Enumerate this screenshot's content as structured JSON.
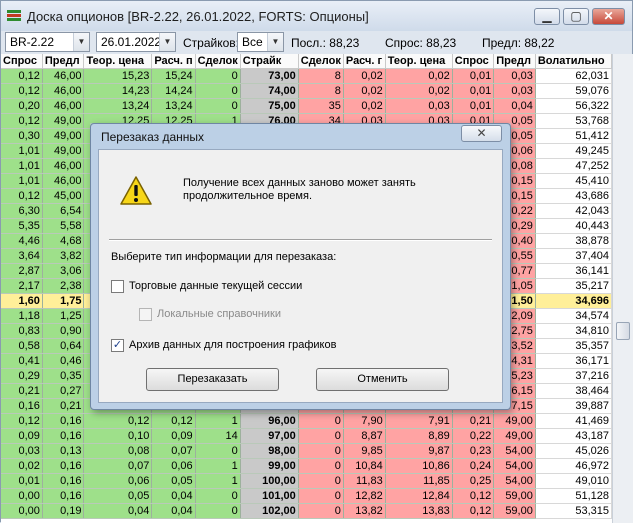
{
  "window": {
    "title": "Доска опционов [BR-2.22, 26.01.2022, FORTS: Опционы]",
    "buttons": {
      "minimize": "▁",
      "maximize": "▢",
      "close": "✕"
    }
  },
  "toolbar": {
    "instrument": "BR-2.22",
    "date": "26.01.2022",
    "strikes_label": "Страйков:",
    "strikes_value": "Все",
    "last_label": "Посл.: 88,23",
    "bid_label": "Спрос: 88,23",
    "ask_label": "Предл: 88,22"
  },
  "columns": [
    "Спрос",
    "Предл",
    "Теор. цена",
    "Расч. п",
    "Сделок",
    "Страйк",
    "Сделок",
    "Расч. г",
    "Теор. цена",
    "Спрос",
    "Предл",
    "Волатильно"
  ],
  "rows": [
    [
      "0,12",
      "46,00",
      "15,23",
      "15,24",
      "0",
      "73,00",
      "8",
      "0,02",
      "0,02",
      "0,01",
      "0,03",
      "62,031"
    ],
    [
      "0,12",
      "46,00",
      "14,23",
      "14,24",
      "0",
      "74,00",
      "8",
      "0,02",
      "0,02",
      "0,01",
      "0,03",
      "59,076"
    ],
    [
      "0,20",
      "46,00",
      "13,24",
      "13,24",
      "0",
      "75,00",
      "35",
      "0,02",
      "0,03",
      "0,01",
      "0,04",
      "56,322"
    ],
    [
      "0,12",
      "49,00",
      "12,25",
      "12,25",
      "1",
      "76,00",
      "34",
      "0,03",
      "0,03",
      "0,01",
      "0,05",
      "53,768"
    ],
    [
      "0,30",
      "49,00",
      "",
      "",
      "",
      "",
      "",
      "",
      "",
      "",
      "0,05",
      "51,412"
    ],
    [
      "1,01",
      "49,00",
      "",
      "",
      "",
      "",
      "",
      "",
      "",
      "",
      "0,06",
      "49,245"
    ],
    [
      "1,01",
      "46,00",
      "",
      "",
      "",
      "",
      "",
      "",
      "",
      "",
      "0,08",
      "47,252"
    ],
    [
      "1,01",
      "46,00",
      "",
      "",
      "",
      "",
      "",
      "",
      "",
      "",
      "0,15",
      "45,410"
    ],
    [
      "0,12",
      "45,00",
      "",
      "",
      "",
      "",
      "",
      "",
      "",
      "",
      "0,15",
      "43,686"
    ],
    [
      "6,30",
      "6,54",
      "",
      "",
      "",
      "",
      "",
      "",
      "",
      "",
      "0,22",
      "42,043"
    ],
    [
      "5,35",
      "5,58",
      "",
      "",
      "",
      "",
      "",
      "",
      "",
      "",
      "0,29",
      "40,443"
    ],
    [
      "4,46",
      "4,68",
      "",
      "",
      "",
      "",
      "",
      "",
      "",
      "",
      "0,40",
      "38,878"
    ],
    [
      "3,64",
      "3,82",
      "",
      "",
      "",
      "",
      "",
      "",
      "",
      "",
      "0,55",
      "37,404"
    ],
    [
      "2,87",
      "3,06",
      "",
      "",
      "",
      "",
      "",
      "",
      "",
      "",
      "0,77",
      "36,141"
    ],
    [
      "2,17",
      "2,38",
      "",
      "",
      "",
      "",
      "",
      "",
      "",
      "",
      "1,05",
      "35,217"
    ],
    [
      "1,60",
      "1,75",
      "",
      "",
      "",
      "",
      "",
      "",
      "",
      "",
      "1,50",
      "34,696"
    ],
    [
      "1,18",
      "1,25",
      "",
      "",
      "",
      "",
      "",
      "",
      "",
      "",
      "2,09",
      "34,574"
    ],
    [
      "0,83",
      "0,90",
      "",
      "",
      "",
      "",
      "",
      "",
      "",
      "",
      "2,75",
      "34,810"
    ],
    [
      "0,58",
      "0,64",
      "",
      "",
      "",
      "",
      "",
      "",
      "",
      "",
      "3,52",
      "35,357"
    ],
    [
      "0,41",
      "0,46",
      "",
      "",
      "",
      "",
      "",
      "",
      "",
      "",
      "4,31",
      "36,171"
    ],
    [
      "0,29",
      "0,35",
      "",
      "",
      "",
      "",
      "",
      "",
      "",
      "",
      "5,23",
      "37,216"
    ],
    [
      "0,21",
      "0,27",
      "",
      "",
      "",
      "",
      "",
      "",
      "",
      "",
      "6,15",
      "38,464"
    ],
    [
      "0,16",
      "0,21",
      "",
      "",
      "",
      "",
      "",
      "",
      "",
      "",
      "7,15",
      "39,887"
    ],
    [
      "0,12",
      "0,16",
      "0,12",
      "0,12",
      "1",
      "96,00",
      "0",
      "7,90",
      "7,91",
      "0,21",
      "49,00",
      "41,469"
    ],
    [
      "0,09",
      "0,16",
      "0,10",
      "0,09",
      "14",
      "97,00",
      "0",
      "8,87",
      "8,89",
      "0,22",
      "49,00",
      "43,187"
    ],
    [
      "0,03",
      "0,13",
      "0,08",
      "0,07",
      "0",
      "98,00",
      "0",
      "9,85",
      "9,87",
      "0,23",
      "54,00",
      "45,026"
    ],
    [
      "0,02",
      "0,16",
      "0,07",
      "0,06",
      "1",
      "99,00",
      "0",
      "10,84",
      "10,86",
      "0,24",
      "54,00",
      "46,972"
    ],
    [
      "0,01",
      "0,16",
      "0,06",
      "0,05",
      "1",
      "100,00",
      "0",
      "11,83",
      "11,85",
      "0,25",
      "54,00",
      "49,010"
    ],
    [
      "0,00",
      "0,16",
      "0,05",
      "0,04",
      "0",
      "101,00",
      "0",
      "12,82",
      "12,84",
      "0,12",
      "59,00",
      "51,128"
    ],
    [
      "0,00",
      "0,19",
      "0,04",
      "0,04",
      "0",
      "102,00",
      "0",
      "13,82",
      "13,83",
      "0,12",
      "59,00",
      "53,315"
    ]
  ],
  "highlight_row": 15,
  "dialog": {
    "title": "Перезаказ данных",
    "close": "✕",
    "message": "Получение всех данных заново может занять продолжительное время.",
    "prompt": "Выберите тип информации для перезаказа:",
    "options": [
      {
        "label": "Торговые данные текущей сессии",
        "checked": false,
        "enabled": true
      },
      {
        "label": "Локальные справочники",
        "checked": false,
        "enabled": false
      },
      {
        "label": "Архив данных для построения графиков",
        "checked": true,
        "enabled": true
      }
    ],
    "ok_label": "Перезаказать",
    "cancel_label": "Отменить"
  },
  "colors": {
    "call_side": "#9ee08a",
    "put_side": "#ffa3a3",
    "strike": "#c9c9c9",
    "highlight": "#ffef99"
  }
}
